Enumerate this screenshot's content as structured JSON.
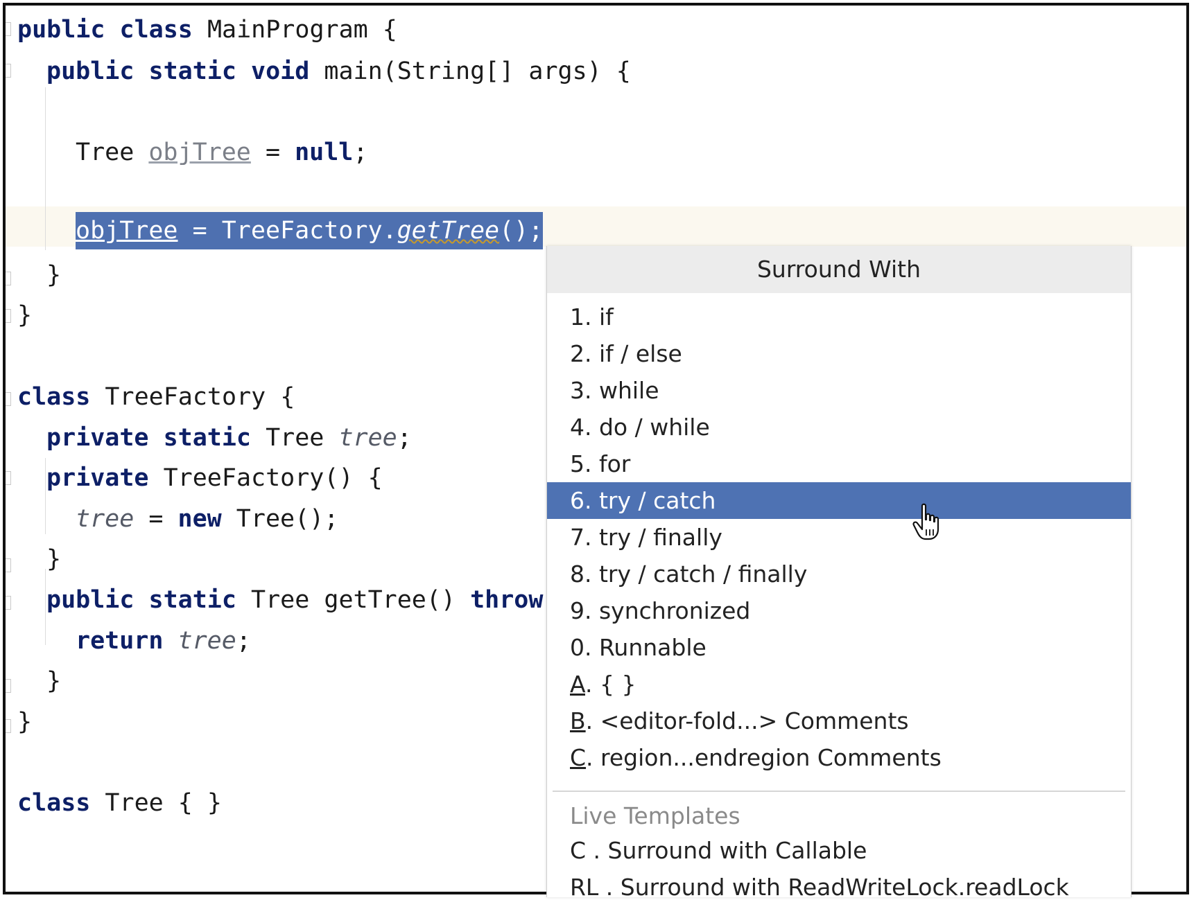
{
  "editor": {
    "l1": {
      "kw": "public class",
      "rest": " MainProgram {"
    },
    "l2": {
      "kw": "public static void",
      "rest": " main(String[] args) {"
    },
    "l3": {
      "type": "Tree ",
      "var": "objTree",
      "eq": " = ",
      "kw": "null",
      "end": ";"
    },
    "l4": {
      "var": "objTree",
      "mid": " = TreeFactory.",
      "method": "getTree",
      "end": "();"
    },
    "l5": "}",
    "l6": "}",
    "l7": {
      "kw": "class",
      "rest": " TreeFactory {"
    },
    "l8": {
      "kw": "private static",
      "mid": " Tree ",
      "field": "tree",
      "end": ";"
    },
    "l9": {
      "kw": "private",
      "rest": " TreeFactory() {"
    },
    "l10": {
      "field": "tree",
      "mid": " = ",
      "kw": "new",
      "rest": " Tree();"
    },
    "l11": "}",
    "l12": {
      "kw": "public static",
      "mid": " Tree getTree() ",
      "kw2": "throw"
    },
    "l13": {
      "kw": "return",
      "sp": " ",
      "field": "tree",
      "end": ";"
    },
    "l14": "}",
    "l15": "}",
    "l16": {
      "kw": "class",
      "rest": " Tree { }"
    }
  },
  "popup": {
    "title": "Surround With",
    "items": [
      {
        "label": "1. if"
      },
      {
        "label": "2. if / else"
      },
      {
        "label": "3. while"
      },
      {
        "label": "4. do / while"
      },
      {
        "label": "5. for"
      },
      {
        "label": "6. try / catch",
        "selected": true
      },
      {
        "label": "7. try / finally"
      },
      {
        "label": "8. try / catch / finally"
      },
      {
        "label": "9. synchronized"
      },
      {
        "label": "0. Runnable"
      },
      {
        "mnemonic": "A",
        "rest": ". { }"
      },
      {
        "mnemonic": "B",
        "rest": ". <editor-fold...> Comments"
      },
      {
        "mnemonic": "C",
        "rest": ". region...endregion Comments"
      }
    ],
    "live_templates": {
      "header": "Live Templates",
      "items": [
        {
          "label": "C . Surround with Callable"
        },
        {
          "label": "RL . Surround with ReadWriteLock.readLock"
        }
      ]
    }
  },
  "colors": {
    "selection": "#4e70b0",
    "menu_selected": "#4e72b3",
    "keyword": "#0d1f66"
  },
  "cursor": "hand-pointer-icon"
}
